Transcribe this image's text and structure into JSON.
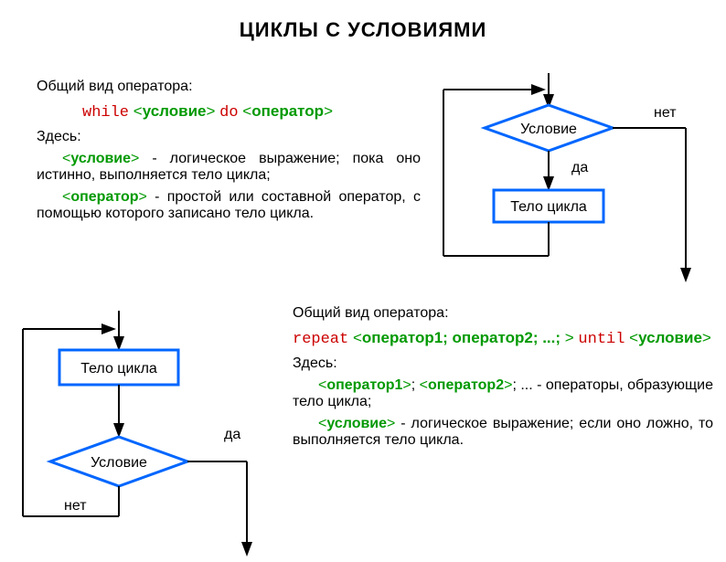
{
  "title": "ЦИКЛЫ С УСЛОВИЯМИ",
  "while": {
    "intro": "Общий вид оператора:",
    "kw_while": "while",
    "cond": "условие",
    "kw_do": "do",
    "op": "оператор",
    "here": "Здесь:",
    "cond_label": "условие",
    "cond_desc_rest": " - логическое выражение; пока оно истинно, выполняется тело цикла;",
    "op_label": "оператор",
    "op_desc_rest": " - простой или составной оператор, с помощью которого записано тело цикла."
  },
  "repeat": {
    "intro": "Общий вид оператора:",
    "kw_repeat": "repeat",
    "ops_inner": "оператор1; оператор2; ...; ",
    "kw_until": "until",
    "cond": "условие",
    "here": "Здесь:",
    "op1": "оператор1",
    "op2": "оператор2",
    "ops_desc_rest": "; ... - операторы, образующие тело цикла;",
    "cond_label": "условие",
    "cond_desc_rest": " - логическое выражение; если оно ложно, то выполняется тело цикла."
  },
  "diag": {
    "condition": "Условие",
    "body": "Тело цикла",
    "yes": "да",
    "no": "нет"
  }
}
